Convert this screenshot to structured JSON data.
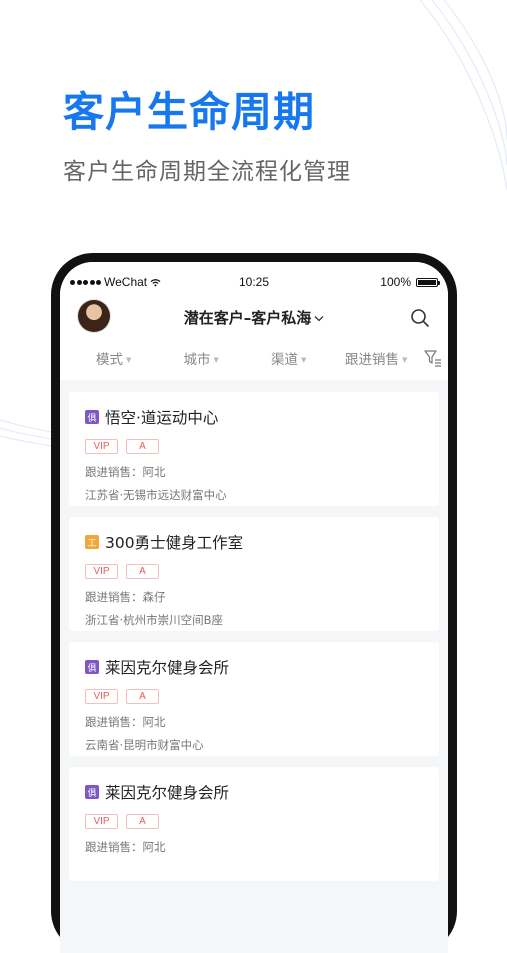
{
  "hero": {
    "title": "客户生命周期",
    "subtitle": "客户生命周期全流程化管理"
  },
  "status_bar": {
    "carrier": "WeChat",
    "time": "10:25",
    "battery": "100%",
    "battery_level": 1.0
  },
  "nav": {
    "title": "潜在客户–客户私海",
    "dropdown_icon": "chevron-down-icon",
    "search_icon": "search-icon"
  },
  "filters": [
    {
      "label": "模式"
    },
    {
      "label": "城市"
    },
    {
      "label": "渠道"
    },
    {
      "label": "跟进销售"
    }
  ],
  "filter_icon": "filter-icon",
  "cards": [
    {
      "badge": "俱",
      "badge_color": "#7e57c2",
      "name": "悟空·道运动中心",
      "tags": [
        "VIP",
        "A"
      ],
      "sales": "跟进销售：阿北",
      "address": "江苏省·无锡市远达财富中心"
    },
    {
      "badge": "工",
      "badge_color": "#f0a73a",
      "name": "300勇士健身工作室",
      "tags": [
        "VIP",
        "A"
      ],
      "sales": "跟进销售：森仔",
      "address": "浙江省·杭州市崇川空间B座"
    },
    {
      "badge": "俱",
      "badge_color": "#7e57c2",
      "name": "莱因克尔健身会所",
      "tags": [
        "VIP",
        "A"
      ],
      "sales": "跟进销售：阿北",
      "address": "云南省·昆明市财富中心"
    },
    {
      "badge": "俱",
      "badge_color": "#7e57c2",
      "name": "莱因克尔健身会所",
      "tags": [
        "VIP",
        "A"
      ],
      "sales": "跟进销售：阿北",
      "address": ""
    }
  ],
  "colors": {
    "accent": "#1677ee",
    "tag_red": "#ef5a5a"
  }
}
